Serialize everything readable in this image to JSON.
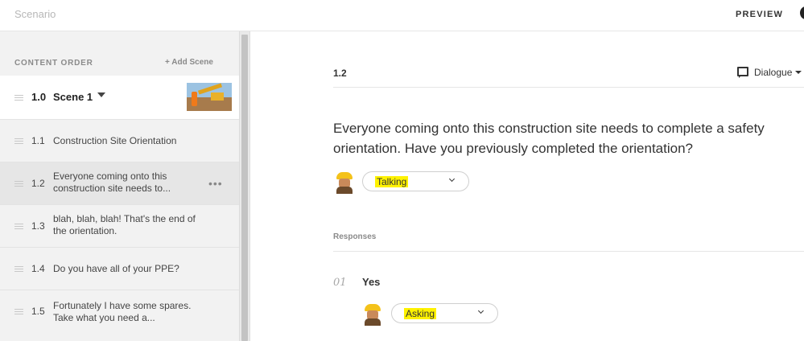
{
  "header": {
    "title": "Scenario",
    "preview_label": "PREVIEW"
  },
  "sidebar": {
    "heading": "CONTENT ORDER",
    "add_scene_label": "+ Add Scene",
    "scene": {
      "number": "1.0",
      "name": "Scene 1"
    },
    "items": [
      {
        "number": "1.1",
        "text": "Construction Site Orientation"
      },
      {
        "number": "1.2",
        "text": "Everyone coming onto this construction site needs to...",
        "active": true,
        "more": "•••"
      },
      {
        "number": "1.3",
        "text": "blah, blah, blah! That's the end of the orientation."
      },
      {
        "number": "1.4",
        "text": "Do you have all of your PPE?"
      },
      {
        "number": "1.5",
        "text": "Fortunately I have some spares. Take what you need a..."
      }
    ]
  },
  "main": {
    "node_id": "1.2",
    "type_selector": "Dialogue",
    "prompt": "Everyone coming onto this construction site needs to complete a safety orientation. Have you previously completed the orientation?",
    "prompt_expression": "Talking",
    "responses_heading": "Responses",
    "responses": [
      {
        "number": "01",
        "text": "Yes",
        "expression": "Asking"
      }
    ]
  },
  "colors": {
    "highlight": "#fff200",
    "sidebar_bg": "#f2f2f2",
    "active_item_bg": "#e6e6e6",
    "helmet": "#f4c21a"
  },
  "icons": [
    "speech-bubble-icon",
    "caret-down-icon",
    "chevron-down-icon",
    "drag-handle-icon",
    "more-options-icon",
    "worker-avatar"
  ]
}
